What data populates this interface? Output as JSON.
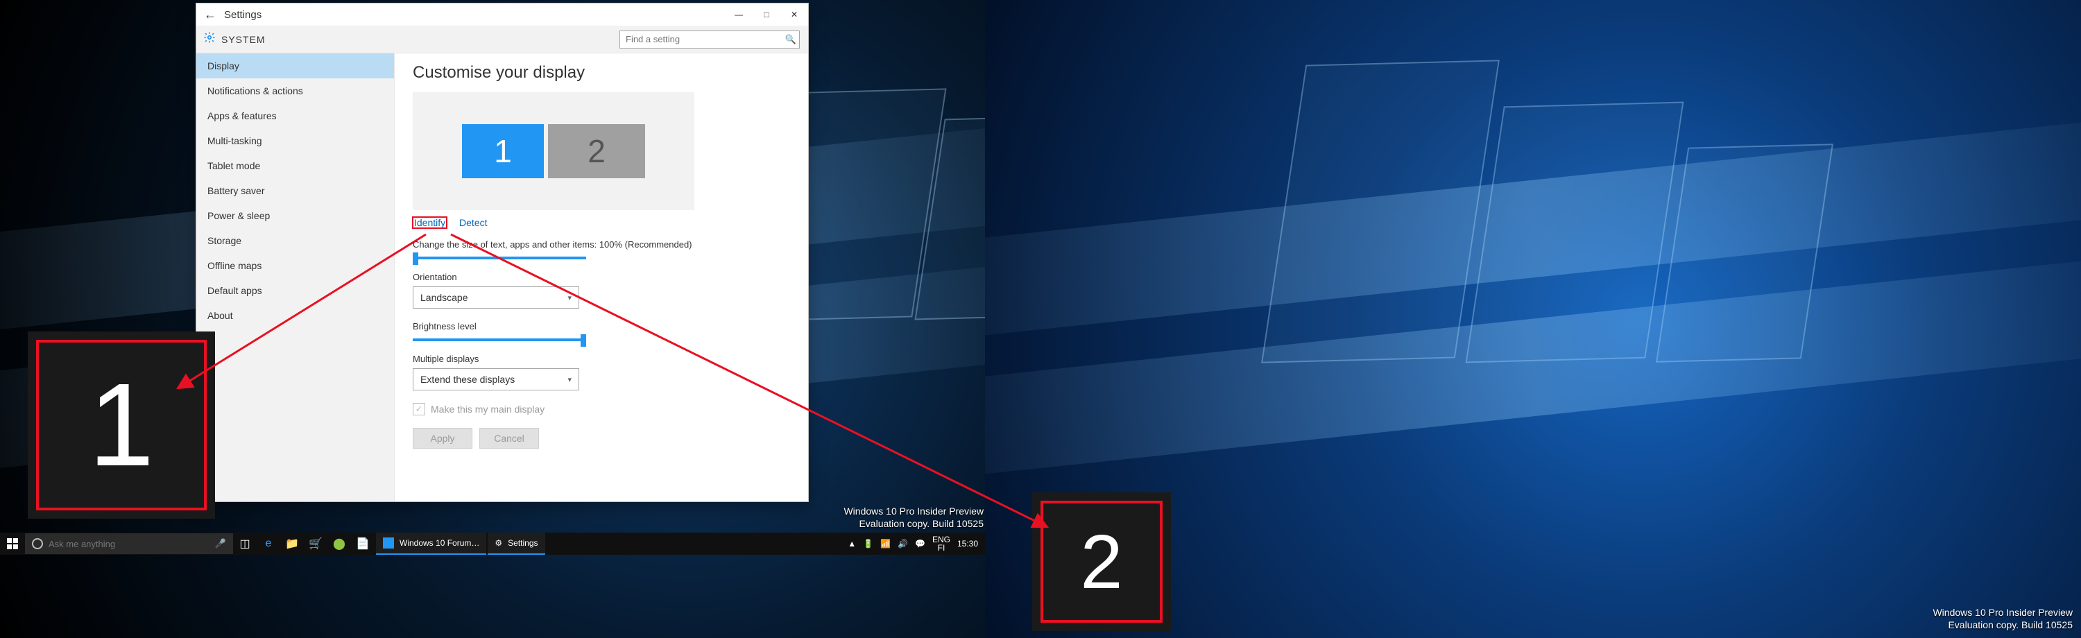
{
  "window": {
    "title": "Settings",
    "section": "SYSTEM",
    "search_placeholder": "Find a setting"
  },
  "sidebar": {
    "items": [
      "Display",
      "Notifications & actions",
      "Apps & features",
      "Multi-tasking",
      "Tablet mode",
      "Battery saver",
      "Power & sleep",
      "Storage",
      "Offline maps",
      "Default apps",
      "About"
    ],
    "selected_index": 0
  },
  "content": {
    "heading": "Customise your display",
    "monitors": {
      "m1": "1",
      "m2": "2"
    },
    "identify_link": "Identify",
    "detect_link": "Detect",
    "scale_label": "Change the size of text, apps and other items: 100% (Recommended)",
    "orientation_label": "Orientation",
    "orientation_value": "Landscape",
    "brightness_label": "Brightness level",
    "multiple_label": "Multiple displays",
    "multiple_value": "Extend these displays",
    "main_display_label": "Make this my main display",
    "apply_label": "Apply",
    "cancel_label": "Cancel"
  },
  "identify_overlays": {
    "ov1": "1",
    "ov2": "2"
  },
  "watermark": {
    "line1": "Windows 10 Pro Insider Preview",
    "line2": "Evaluation copy. Build 10525"
  },
  "taskbar": {
    "cortana_placeholder": "Ask me anything",
    "task_buttons": [
      "Windows 10 Forum…",
      "Settings"
    ],
    "tray": {
      "lang_top": "ENG",
      "lang_bottom": "FI",
      "clock": "15:30"
    }
  }
}
